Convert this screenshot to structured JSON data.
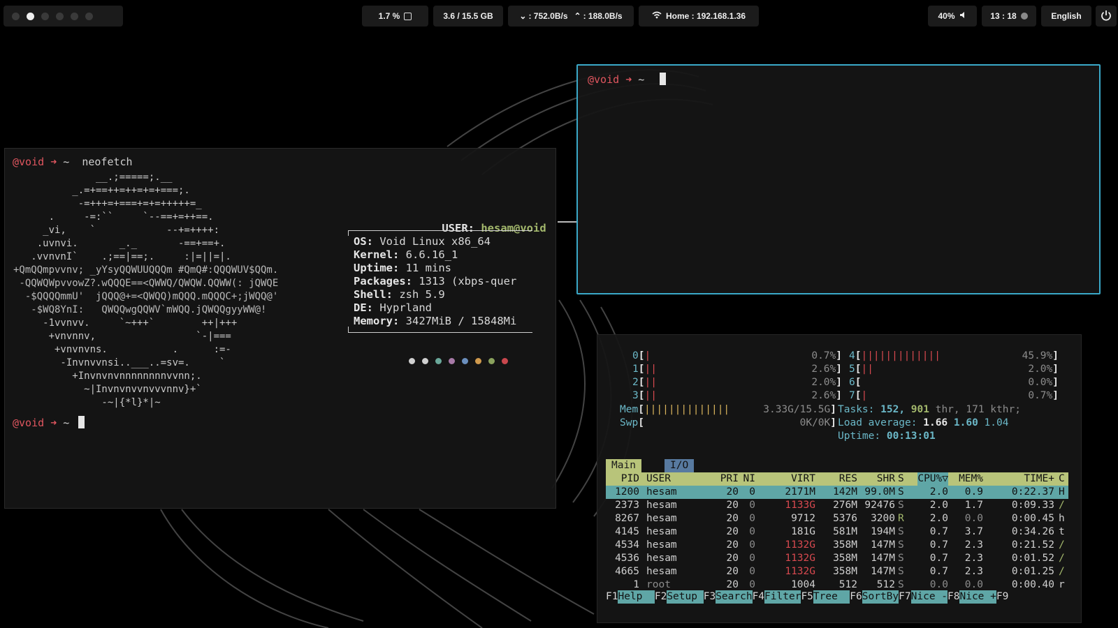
{
  "topbar": {
    "cpu": "1.7 %",
    "memory": "3.6 / 15.5 GB",
    "net_down": ": 752.0B/s",
    "net_up": ": 188.0B/s",
    "wifi": "Home : 192.168.1.36",
    "volume": "40%",
    "time": "13 : 18",
    "language": "English"
  },
  "terminal_left": {
    "prompt_user": "@void",
    "prompt_arrow": "➜",
    "prompt_dir": "~",
    "command": "neofetch",
    "ascii_lines": [
      "              __.;=====;.__",
      "          _.=+==++=++=+=+===;.",
      "           -=+++=+===+=+=+++++=_",
      "      .     -=:``     `--==+=++==.",
      "     _vi,    `            --+=++++:",
      "    .uvnvi.       _._       -==+==+.",
      "   .vvnvnI`    .;==|==;.     :|=||=|.",
      "+QmQQmpvvnv; _yYsyQQWUUQQQm #QmQ#:QQQWUV$QQm.",
      " -QQWQWpvvowZ?.wQQQE==<QWWQ/QWQW.QQWW(: jQWQE",
      "  -$QQQQmmU'  jQQQ@+=<QWQQ)mQQQ.mQQQC+;jWQQ@'",
      "   -$WQ8YnI:   QWQQwgQQWV`mWQQ.jQWQQgyyWW@!",
      "     -1vvnvv.     `~+++`        ++|+++",
      "      +vnvnnv,                 `-|===",
      "       +vnvnvns.           .      :=-",
      "        -Invnvvnsi..___..=sv=.     `",
      "          +Invnvnvnnnnnnnnvvnn;.",
      "            ~|Invnvnvvnvvvnnv}+`",
      "               -~|{*l}*|~"
    ],
    "info_user_label": "USER",
    "info_user_value": "hesam@void",
    "info": [
      {
        "k": "OS",
        "v": "Void Linux x86_64"
      },
      {
        "k": "Kernel",
        "v": "6.6.16_1"
      },
      {
        "k": "Uptime",
        "v": "11 mins"
      },
      {
        "k": "Packages",
        "v": "1313 (xbps-quer"
      },
      {
        "k": "Shell",
        "v": "zsh 5.9"
      },
      {
        "k": "DE",
        "v": "Hyprland"
      },
      {
        "k": "Memory",
        "v": "3427MiB / 15848Mi"
      }
    ],
    "palette": [
      "#d0d0d0",
      "#d0d0d0",
      "#6aa89a",
      "#a77aa7",
      "#6b8fbe",
      "#d09a4d",
      "#8aa25d",
      "#c9474d"
    ]
  },
  "terminal_right": {
    "prompt_user": "@void",
    "prompt_arrow": "➜",
    "prompt_dir": "~"
  },
  "htop": {
    "cpus_left": [
      {
        "id": "0",
        "bar": "|",
        "pct": "0.7%"
      },
      {
        "id": "1",
        "bar": "||",
        "pct": "2.6%"
      },
      {
        "id": "2",
        "bar": "||",
        "pct": "2.0%"
      },
      {
        "id": "3",
        "bar": "||",
        "pct": "2.6%"
      }
    ],
    "cpus_right": [
      {
        "id": "4",
        "bar": "|||||||||||||",
        "pct": "45.9%"
      },
      {
        "id": "5",
        "bar": "||",
        "pct": "2.0%"
      },
      {
        "id": "6",
        "bar": "",
        "pct": "0.0%"
      },
      {
        "id": "7",
        "bar": "|",
        "pct": "0.7%"
      }
    ],
    "mem_label": "Mem",
    "mem_bar": "||||||||||||||",
    "mem_value": "3.33G/15.5G",
    "swp_label": "Swp",
    "swp_value": "0K/0K",
    "tasks_label": "Tasks:",
    "tasks_count": "152,",
    "threads_count": "901",
    "threads_text": "thr,",
    "kthr_text": "171 kthr;",
    "load_label": "Load average:",
    "load1": "1.66",
    "load5": "1.60",
    "load15": "1.04",
    "uptime_label": "Uptime:",
    "uptime_value": "00:13:01",
    "tab_main": "Main",
    "tab_io": "I/O",
    "columns": [
      "PID",
      "USER",
      "PRI",
      "NI",
      "VIRT",
      "RES",
      "SHR",
      "S",
      "CPU%▽",
      "MEM%",
      "TIME+",
      "C"
    ],
    "processes": [
      {
        "pid": "1200",
        "user": "hesam",
        "pri": "20",
        "ni": "0",
        "virt": "2171M",
        "res": "142M",
        "shr": "99.0M",
        "s": "S",
        "cpu": "2.0",
        "mem": "0.9",
        "time": "0:22.37",
        "c": "H"
      },
      {
        "pid": "2373",
        "user": "hesam",
        "pri": "20",
        "ni": "0",
        "virt": "1133G",
        "res": "276M",
        "shr": "92476",
        "s": "S",
        "cpu": "2.0",
        "mem": "1.7",
        "time": "0:09.33",
        "c": "/"
      },
      {
        "pid": "8267",
        "user": "hesam",
        "pri": "20",
        "ni": "0",
        "virt": "9712",
        "res": "5376",
        "shr": "3200",
        "s": "R",
        "cpu": "2.0",
        "mem": "0.0",
        "time": "0:00.45",
        "c": "h"
      },
      {
        "pid": "4145",
        "user": "hesam",
        "pri": "20",
        "ni": "0",
        "virt": "181G",
        "res": "581M",
        "shr": "194M",
        "s": "S",
        "cpu": "0.7",
        "mem": "3.7",
        "time": "0:34.26",
        "c": "t"
      },
      {
        "pid": "4534",
        "user": "hesam",
        "pri": "20",
        "ni": "0",
        "virt": "1132G",
        "res": "358M",
        "shr": "147M",
        "s": "S",
        "cpu": "0.7",
        "mem": "2.3",
        "time": "0:21.52",
        "c": "/"
      },
      {
        "pid": "4536",
        "user": "hesam",
        "pri": "20",
        "ni": "0",
        "virt": "1132G",
        "res": "358M",
        "shr": "147M",
        "s": "S",
        "cpu": "0.7",
        "mem": "2.3",
        "time": "0:01.52",
        "c": "/"
      },
      {
        "pid": "4665",
        "user": "hesam",
        "pri": "20",
        "ni": "0",
        "virt": "1132G",
        "res": "358M",
        "shr": "147M",
        "s": "S",
        "cpu": "0.7",
        "mem": "2.3",
        "time": "0:01.25",
        "c": "/"
      },
      {
        "pid": "1",
        "user": "root",
        "pri": "20",
        "ni": "0",
        "virt": "1004",
        "res": "512",
        "shr": "512",
        "s": "S",
        "cpu": "0.0",
        "mem": "0.0",
        "time": "0:00.40",
        "c": "r"
      }
    ],
    "fkeys": [
      {
        "n": "F1",
        "l": "Help  "
      },
      {
        "n": "F2",
        "l": "Setup "
      },
      {
        "n": "F3",
        "l": "Search"
      },
      {
        "n": "F4",
        "l": "Filter"
      },
      {
        "n": "F5",
        "l": "Tree  "
      },
      {
        "n": "F6",
        "l": "SortBy"
      },
      {
        "n": "F7",
        "l": "Nice -"
      },
      {
        "n": "F8",
        "l": "Nice +"
      },
      {
        "n": "F9",
        "l": ""
      }
    ]
  }
}
